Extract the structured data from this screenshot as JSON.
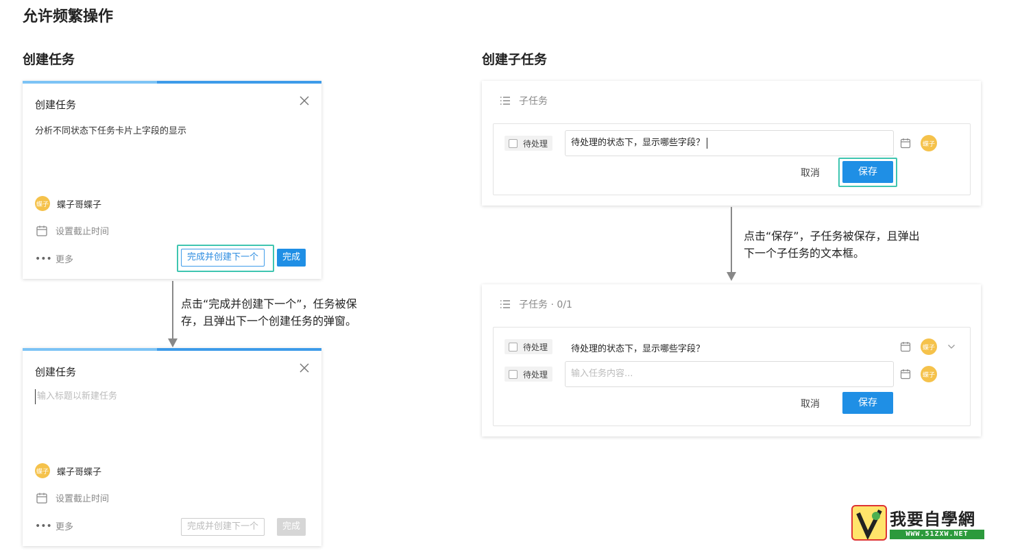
{
  "page_title": "允许频繁操作",
  "left": {
    "section_title": "创建任务",
    "modal1": {
      "title": "创建任务",
      "content": "分析不同状态下任务卡片上字段的显示",
      "avatar_text": "蝶子",
      "assignee": "蝶子哥蝶子",
      "due_date": "设置截止时间",
      "more": "更多",
      "btn_next": "完成并创建下一个",
      "btn_done": "完成"
    },
    "annotation": [
      "点击“完成并创建下一个”，任务被保",
      "存，且弹出下一个创建任务的弹窗。"
    ],
    "modal2": {
      "title": "创建任务",
      "placeholder": "输入标题以新建任务",
      "avatar_text": "蝶子",
      "assignee": "蝶子哥蝶子",
      "due_date": "设置截止时间",
      "more": "更多",
      "btn_next": "完成并创建下一个",
      "btn_done": "完成"
    }
  },
  "right": {
    "section_title": "创建子任务",
    "panel1": {
      "header": "子任务",
      "status": "待处理",
      "input_value": "待处理的状态下，显示哪些字段？",
      "avatar_text": "蝶子",
      "cancel": "取消",
      "save": "保存"
    },
    "annotation": [
      "点击“保存”，子任务被保存，且弹出",
      "下一个子任务的文本框。"
    ],
    "panel2": {
      "header": "子任务 · 0/1",
      "row1_status": "待处理",
      "row1_text": "待处理的状态下，显示哪些字段？",
      "row2_status": "待处理",
      "row2_placeholder": "输入任务内容...",
      "avatar_text": "蝶子",
      "cancel": "取消",
      "save": "保存"
    }
  },
  "watermark": {
    "name": "我要自學網",
    "url": "WWW.51ZXW.NET"
  },
  "colors": {
    "primary": "#1f8fe5",
    "highlight": "#3ec5b0",
    "avatar": "#f5c24b",
    "title_underline": "#b7eadc"
  }
}
